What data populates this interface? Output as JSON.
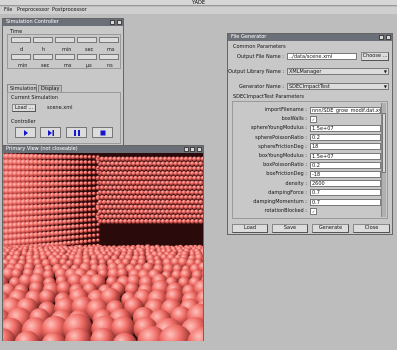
{
  "app": {
    "title": "YADE"
  },
  "menu": [
    "File",
    "Preprocessor",
    "Postprocessor"
  ],
  "sim": {
    "title": "Simulation Controller",
    "time_label": "Time",
    "units_row1": [
      "d",
      "h",
      "min",
      "sec",
      "ms"
    ],
    "units_row2": [
      "min",
      "sec",
      "ms",
      "µs",
      "ns"
    ],
    "tabs": [
      "Simulation",
      "Display"
    ],
    "current_label": "Current Simulation",
    "load_label": "Load ...",
    "file": "scene.xml",
    "controller_label": "Controller"
  },
  "view": {
    "title": "Primary View (not closeable)"
  },
  "gen": {
    "title": "File Generator",
    "common_header": "Common Parameters",
    "output_file_label": "Output File Name :",
    "output_file": "../data/scene.xml",
    "choose": "Choose ...",
    "output_library_label": "Output Library Name :",
    "output_library": "XMLManager",
    "generator_label": "Generator Name :",
    "generator": "SDECImpactTest",
    "params_header": "SDECImpactTest Parameters",
    "params": [
      {
        "label": "importFilename :",
        "value": "nnn/SDE_grow_modif.dat.xyz"
      },
      {
        "label": "boxWalls :",
        "value": "✓"
      },
      {
        "label": "sphereYoungModulus :",
        "value": "1.5e+07"
      },
      {
        "label": "spherePoissonRatio :",
        "value": "0.2"
      },
      {
        "label": "sphereFrictionDeg :",
        "value": "18"
      },
      {
        "label": "boxYoungModulus :",
        "value": "1.5e+07"
      },
      {
        "label": "boxPoissonRatio :",
        "value": "0.2"
      },
      {
        "label": "boxFrictionDeg :",
        "value": "-18"
      },
      {
        "label": "density :",
        "value": "2600"
      },
      {
        "label": "dampingForce :",
        "value": "0.7"
      },
      {
        "label": "dampingMomentum :",
        "value": "0.7"
      },
      {
        "label": "rotationBlocked :",
        "value": "✓"
      }
    ],
    "buttons": [
      "Load",
      "Save",
      "Generate",
      "Close"
    ]
  },
  "colors": {
    "sphere": "#f06c66",
    "wall": "#cf5b55",
    "floor_bg": "#2a0a0a"
  }
}
